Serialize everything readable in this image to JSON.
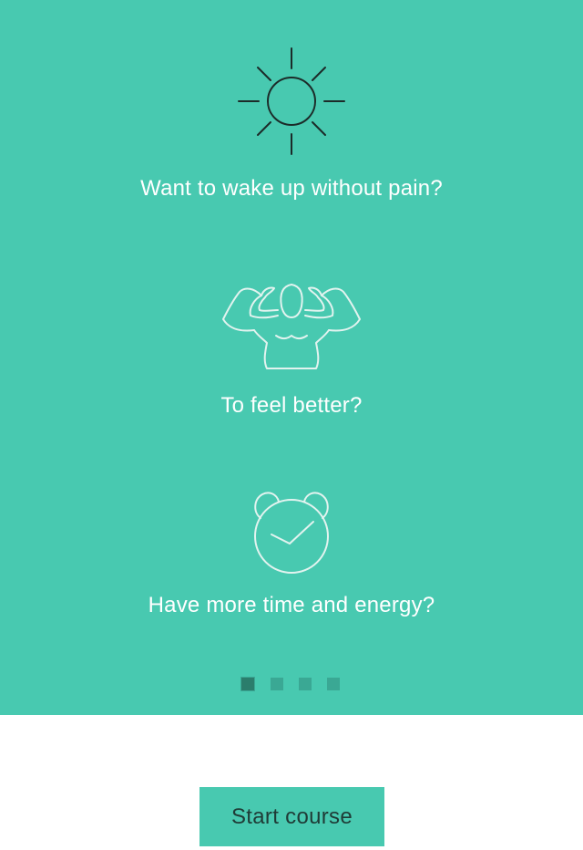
{
  "theme": {
    "accent": "#48c9b0",
    "dot_active": "#2b7d6c",
    "dot_inactive": "#3aa894",
    "button_text": "#1f3b36"
  },
  "features": [
    {
      "icon": "sun-icon",
      "text": "Want to wake up without pain?"
    },
    {
      "icon": "muscle-body-icon",
      "text": "To feel better?"
    },
    {
      "icon": "alarm-clock-icon",
      "text": "Have more time and energy?"
    }
  ],
  "pagination": {
    "total": 4,
    "current": 1
  },
  "actions": {
    "start_label": "Start course"
  }
}
